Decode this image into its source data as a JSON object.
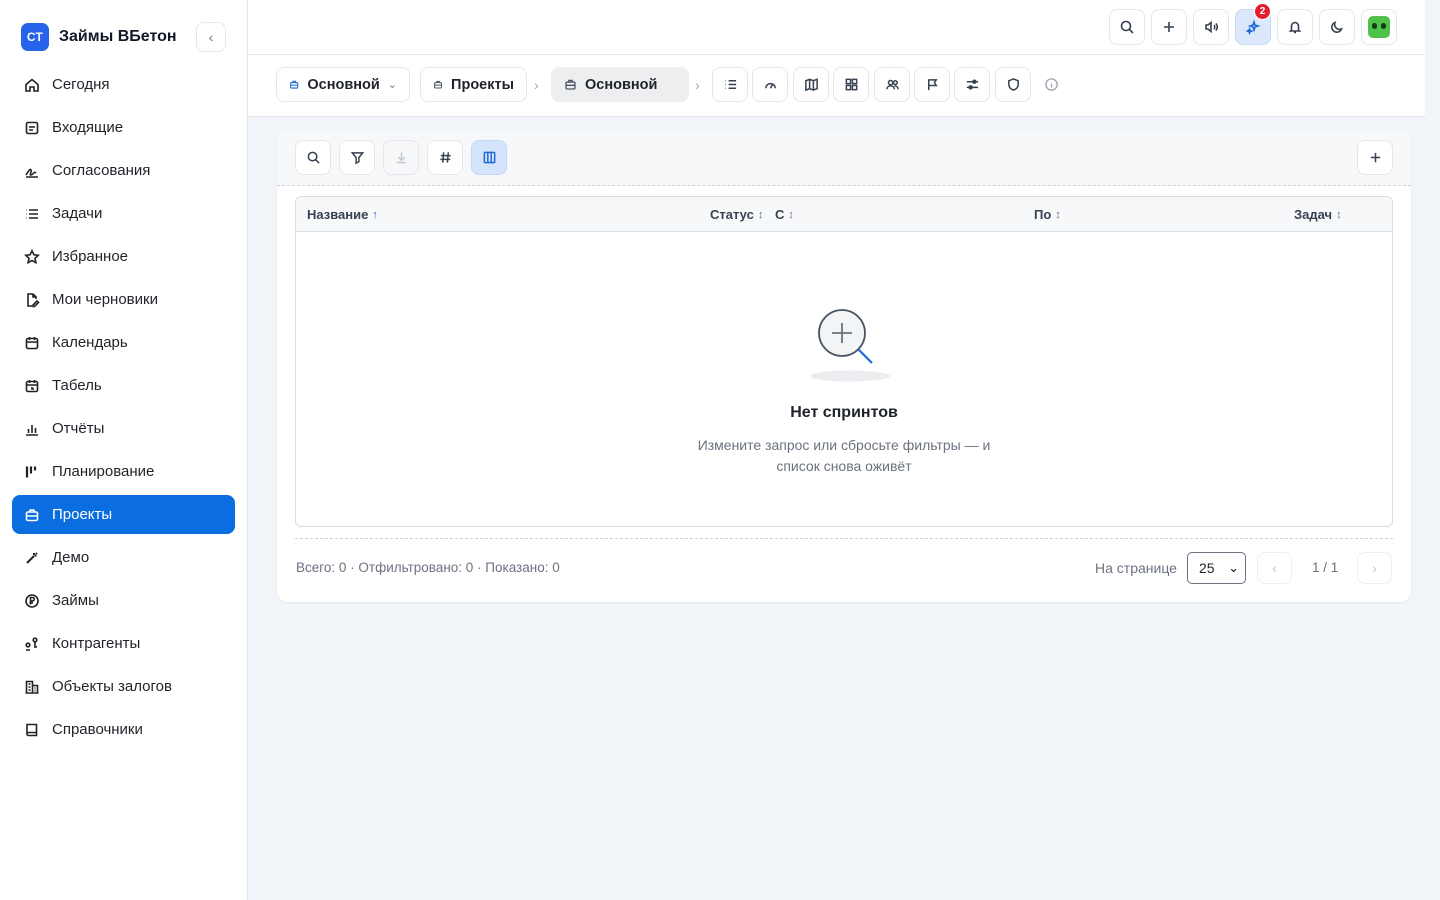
{
  "app": {
    "logo_text": "СТ",
    "name": "Займы ВБетон"
  },
  "sidebar": {
    "items": [
      {
        "label": "Сегодня",
        "icon": "home-icon"
      },
      {
        "label": "Входящие",
        "icon": "inbox-icon"
      },
      {
        "label": "Согласования",
        "icon": "signature-icon"
      },
      {
        "label": "Задачи",
        "icon": "list-icon"
      },
      {
        "label": "Избранное",
        "icon": "star-icon"
      },
      {
        "label": "Мои черновики",
        "icon": "draft-icon"
      },
      {
        "label": "Календарь",
        "icon": "calendar-icon"
      },
      {
        "label": "Табель",
        "icon": "timesheet-icon"
      },
      {
        "label": "Отчёты",
        "icon": "bar-chart-icon"
      },
      {
        "label": "Планирование",
        "icon": "kanban-icon"
      },
      {
        "label": "Проекты",
        "icon": "briefcase-icon",
        "active": true
      },
      {
        "label": "Демо",
        "icon": "wand-icon"
      },
      {
        "label": "Займы",
        "icon": "ruble-icon"
      },
      {
        "label": "Контрагенты",
        "icon": "people-icon"
      },
      {
        "label": "Объекты залогов",
        "icon": "building-icon"
      },
      {
        "label": "Справочники",
        "icon": "book-icon"
      }
    ]
  },
  "topbar": {
    "notification_count": "2"
  },
  "breadcrumb": {
    "workspace": "Основной",
    "section": "Проекты",
    "project": "Основной"
  },
  "table": {
    "columns": [
      {
        "label": "Название",
        "sort": "↑"
      },
      {
        "label": "Статус",
        "sort": "↕"
      },
      {
        "label": "С",
        "sort": "↕"
      },
      {
        "label": "По",
        "sort": "↕"
      },
      {
        "label": "Задач",
        "sort": "↕"
      }
    ],
    "rows": []
  },
  "empty_state": {
    "title": "Нет спринтов",
    "description": "Измените запрос или сбросьте фильтры — и список снова оживёт"
  },
  "footer": {
    "stats": "Всего: 0 · Отфильтровано: 0 · Показано: 0",
    "per_page_label": "На странице",
    "per_page_value": "25",
    "page_indicator": "1 / 1",
    "prev": "‹",
    "next": "›"
  },
  "colors": {
    "accent": "#0b6ee0",
    "badge": "#e11d2e",
    "brand_logo": "#2563eb"
  }
}
